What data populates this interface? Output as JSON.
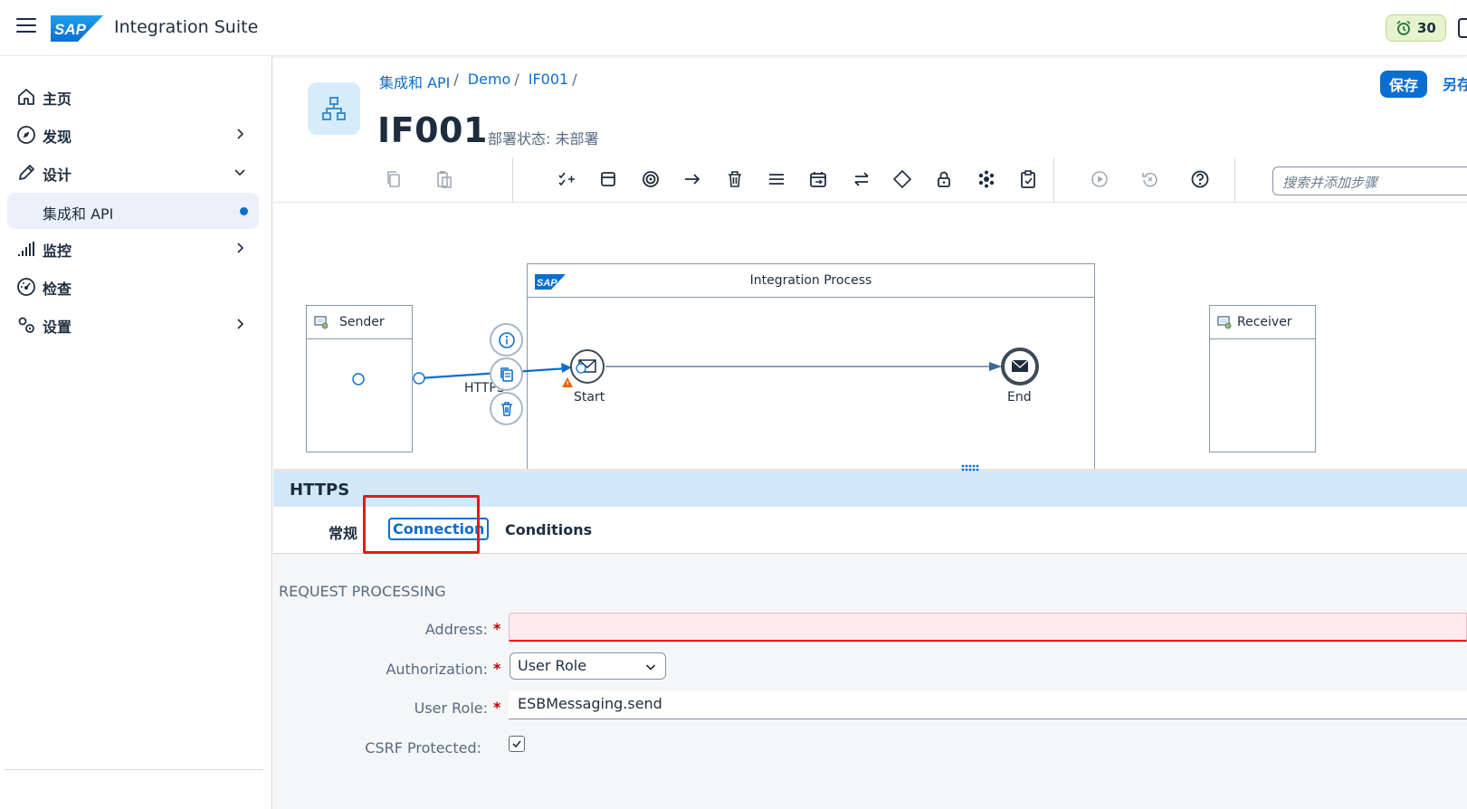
{
  "shell": {
    "product_name": "Integration Suite",
    "logo_text": "SAP",
    "notification_count": "30",
    "brand_color": "#0a6ed1"
  },
  "sidebar": {
    "items": [
      {
        "label": "主页",
        "icon": "home-icon"
      },
      {
        "label": "发现",
        "icon": "compass-icon",
        "expandable": true
      },
      {
        "label": "设计",
        "icon": "pencil-icon",
        "expanded": true
      },
      {
        "label": "集成和 API",
        "selected": true
      },
      {
        "label": "监控",
        "icon": "chart-icon",
        "expandable": true
      },
      {
        "label": "检查",
        "icon": "gauge-icon"
      },
      {
        "label": "设置",
        "icon": "gears-icon",
        "expandable": true
      }
    ]
  },
  "header": {
    "breadcrumbs": [
      "集成和 API",
      "Demo",
      "IF001"
    ],
    "breadcrumb_separator": "/",
    "title": "IF001",
    "status": "部署状态: 未部署",
    "save_label": "保存",
    "save_as_label": "另存"
  },
  "toolbar": {
    "search_placeholder": "搜索并添加步骤"
  },
  "canvas": {
    "integration_process_title": "Integration Process",
    "sender_label": "Sender",
    "receiver_label": "Receiver",
    "connection_label": "HTTPS",
    "start_label": "Start",
    "end_label": "End",
    "pool_logo_text": "SAP"
  },
  "panel": {
    "title": "HTTPS",
    "tabs": [
      "常规",
      "Connection",
      "Conditions"
    ],
    "active_tab": "Connection",
    "section_title": "REQUEST PROCESSING",
    "fields": {
      "address_label": "Address:",
      "address_value": "",
      "authorization_label": "Authorization:",
      "authorization_value": "User Role",
      "user_role_label": "User Role:",
      "user_role_value": "ESBMessaging.send",
      "csrf_label": "CSRF Protected:",
      "csrf_checked": true
    },
    "required_marker": "*"
  }
}
